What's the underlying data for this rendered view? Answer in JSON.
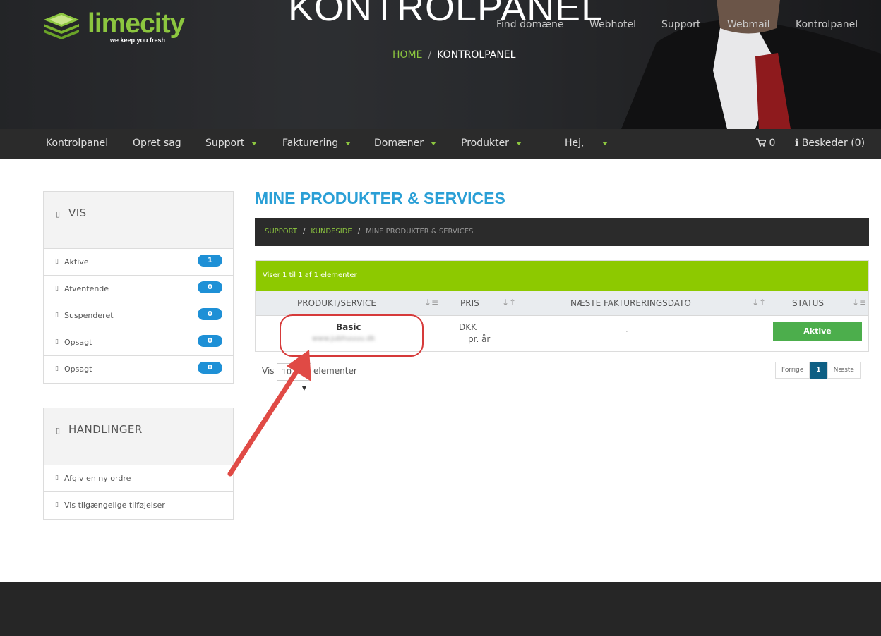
{
  "brand": {
    "logo_text": "limecity",
    "tagline": "we keep you fresh",
    "green": "#8cc63f"
  },
  "hero": {
    "title": "KONTROLPANEL",
    "breadcrumb": {
      "home": "HOME",
      "separator": "/",
      "current": "KONTROLPANEL"
    }
  },
  "topnav": {
    "items": [
      "Find domæne",
      "Webhotel",
      "Support",
      "Webmail",
      "Kontrolpanel"
    ]
  },
  "mainnav": {
    "items": [
      "Kontrolpanel",
      "Opret sag",
      "Support",
      "Fakturering",
      "Domæner",
      "Produkter",
      "Hej,"
    ],
    "cart_count": "0",
    "messages": "Beskeder (0)"
  },
  "sidebar": {
    "vis": {
      "title": "VIS",
      "items": [
        {
          "label": "Aktive",
          "count": "1"
        },
        {
          "label": "Afventende",
          "count": "0"
        },
        {
          "label": "Suspenderet",
          "count": "0"
        },
        {
          "label": "Opsagt",
          "count": "0"
        },
        {
          "label": "Opsagt",
          "count": "0"
        }
      ]
    },
    "actions": {
      "title": "HANDLINGER",
      "items": [
        "Afgiv en ny ordre",
        "Vis tilgængelige tilføjelser"
      ]
    }
  },
  "main": {
    "title": "MINE PRODUKTER & SERVICES",
    "breadcrumb": {
      "items": [
        "SUPPORT",
        "KUNDESIDE"
      ],
      "separator": "/",
      "current": "MINE PRODUKTER & SERVICES"
    },
    "table": {
      "info": "Viser 1 til 1 af 1 elementer",
      "columns": [
        "PRODUKT/SERVICE",
        "PRIS",
        "NÆSTE FAKTURERINGSDATO",
        "STATUS"
      ],
      "rows": [
        {
          "product": "Basic",
          "domain": "www.jubhuuuu.dk",
          "price_currency": "DKK",
          "price_period": "pr. år",
          "next_date": ".",
          "status": "Aktive"
        }
      ]
    },
    "length": {
      "prefix": "Vis",
      "value": "10",
      "suffix": "elementer"
    },
    "pager": {
      "prev": "Forrige",
      "page": "1",
      "next": "Næste"
    }
  }
}
